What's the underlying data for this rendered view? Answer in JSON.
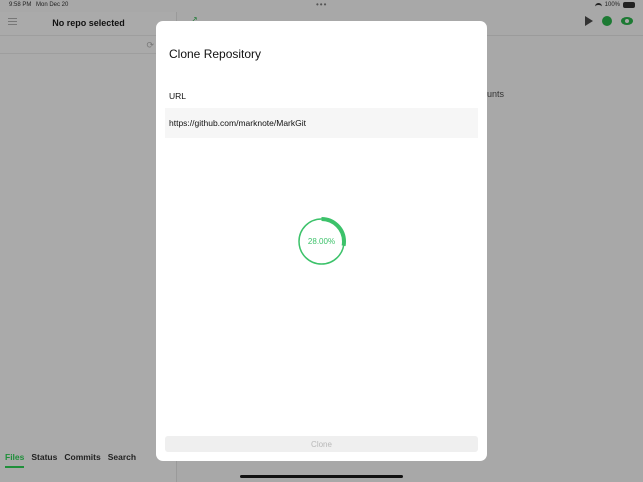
{
  "status_bar": {
    "time": "9:58 PM",
    "date": "Mon Dec 20",
    "battery": "100%"
  },
  "sidebar": {
    "title": "No repo selected",
    "tabs": [
      {
        "label": "Files",
        "active": true
      },
      {
        "label": "Status",
        "active": false
      },
      {
        "label": "Commits",
        "active": false
      },
      {
        "label": "Search",
        "active": false
      }
    ]
  },
  "main": {
    "partial_text": "unts"
  },
  "modal": {
    "title": "Clone Repository",
    "url_label": "URL",
    "url_value": "https://github.com/marknote/MarkGit",
    "progress": 28.0,
    "progress_label": "28.00%",
    "clone_label": "Clone"
  },
  "colors": {
    "accent": "#3cc26a",
    "tab_active": "#1f8f3a"
  }
}
